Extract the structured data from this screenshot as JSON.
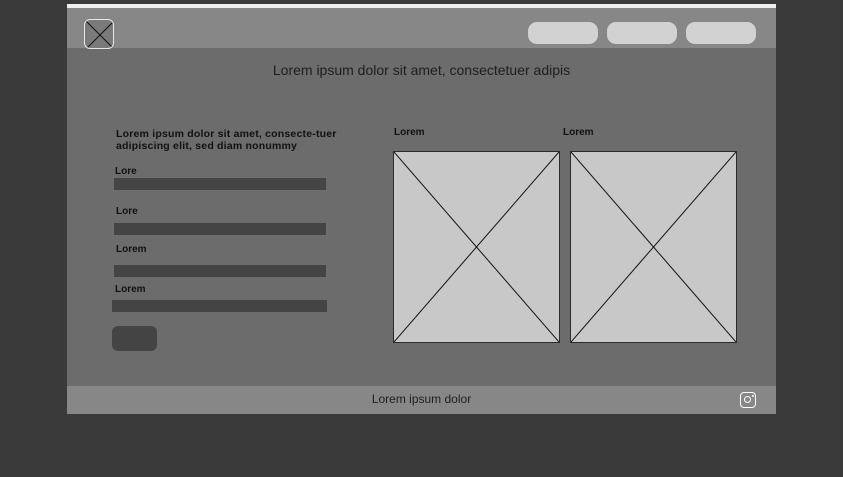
{
  "colors": {
    "page_background": "#3a3a3a",
    "frame_background": "#6c6c6c",
    "bar_background": "#878787",
    "nav_button": "#d2d2d2",
    "field": "#444444",
    "placeholder_image": "#c8c8c8"
  },
  "header": {
    "logo_icon": "logo-placeholder-x-icon",
    "nav_buttons": [
      "",
      "",
      ""
    ]
  },
  "hero": {
    "text": "Lorem ipsum dolor sit amet, consectetuer adipis"
  },
  "form": {
    "title": "Lorem ipsum dolor sit amet, consecte-tuer adipiscing elit, sed diam nonummy",
    "fields": [
      {
        "label": "Lore",
        "value": ""
      },
      {
        "label": "Lore",
        "value": ""
      },
      {
        "label": "Lorem",
        "value": ""
      },
      {
        "label": "Lorem",
        "value": ""
      }
    ],
    "submit_label": ""
  },
  "gallery": {
    "items": [
      {
        "label": "Lorem",
        "icon": "image-placeholder-icon"
      },
      {
        "label": "Lorem",
        "icon": "image-placeholder-icon"
      }
    ]
  },
  "footer": {
    "text": "Lorem ipsum dolor",
    "social_icon": "instagram-icon"
  }
}
